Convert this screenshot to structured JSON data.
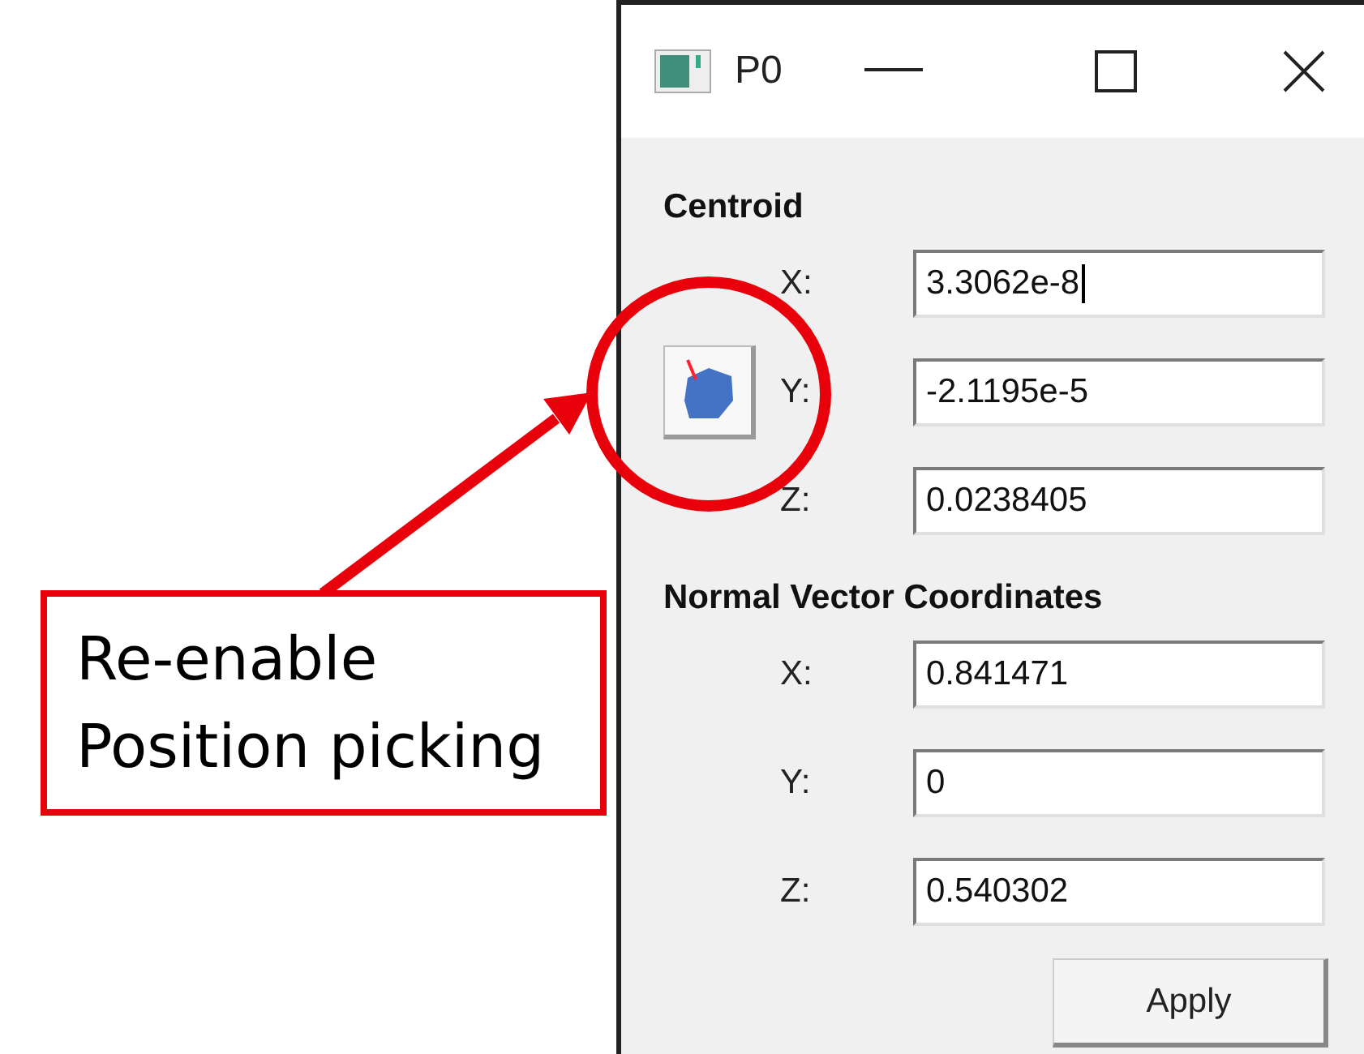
{
  "window": {
    "title": "P0"
  },
  "sections": [
    {
      "heading": "Centroid",
      "fields": [
        {
          "label": "X:",
          "value": "3.3062e-8",
          "focused": true,
          "pick_button": false
        },
        {
          "label": "Y:",
          "value": "-2.1195e-5",
          "focused": false,
          "pick_button": true
        },
        {
          "label": "Z:",
          "value": "0.0238405",
          "focused": false,
          "pick_button": false
        }
      ]
    },
    {
      "heading": "Normal Vector Coordinates",
      "fields": [
        {
          "label": "X:",
          "value": "0.841471",
          "focused": false,
          "pick_button": false
        },
        {
          "label": "Y:",
          "value": "0",
          "focused": false,
          "pick_button": false
        },
        {
          "label": "Z:",
          "value": "0.540302",
          "focused": false,
          "pick_button": false
        }
      ]
    }
  ],
  "buttons": [
    "Apply"
  ],
  "callout": {
    "lines": [
      "Re-enable",
      "Position picking"
    ]
  }
}
